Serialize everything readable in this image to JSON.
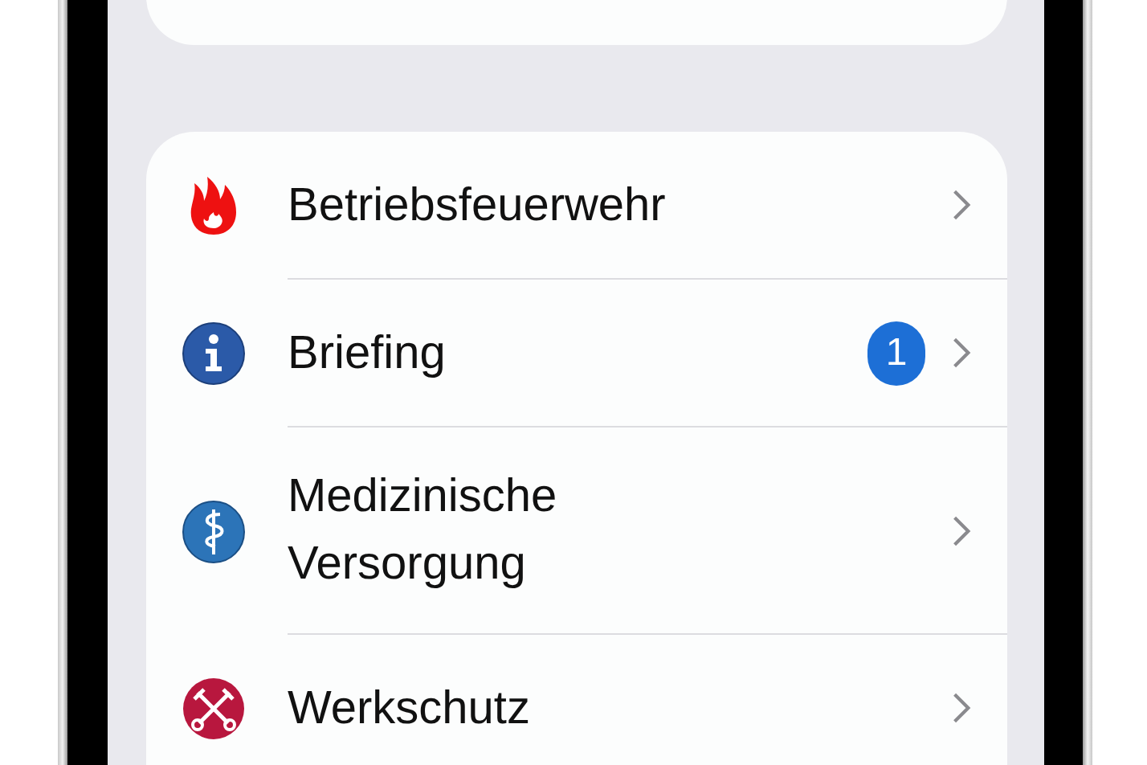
{
  "menu": [
    {
      "label": "Betriebsfeuerwehr"
    },
    {
      "label": "Briefing",
      "badge": "1"
    },
    {
      "label": "Medizinische\nVersorgung"
    },
    {
      "label": "Werkschutz"
    }
  ]
}
